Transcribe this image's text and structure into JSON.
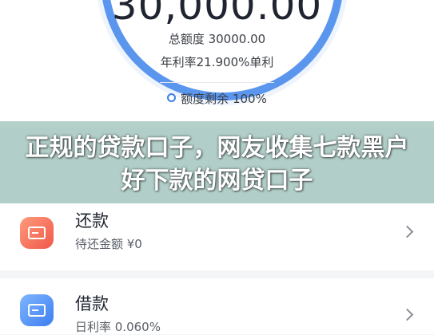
{
  "summary": {
    "big_amount": "30,000.00",
    "quota_text": "总额度 30000.00",
    "rate_text": "年利率21.900%单利",
    "remaining_text": "额度剩余 100%"
  },
  "headline": {
    "text": "正规的贷款口子，网友收集七款黑户好下款的网贷口子"
  },
  "cards": [
    {
      "title": "还款",
      "subtitle": "待还金额 ¥0",
      "icon": "card-repay-icon"
    },
    {
      "title": "借款",
      "subtitle": "日利率 0.060%",
      "icon": "card-borrow-icon"
    }
  ],
  "colors": {
    "gauge": "#5b96ee",
    "repay_icon": "#f0584a",
    "borrow_icon": "#3d7ef0"
  }
}
